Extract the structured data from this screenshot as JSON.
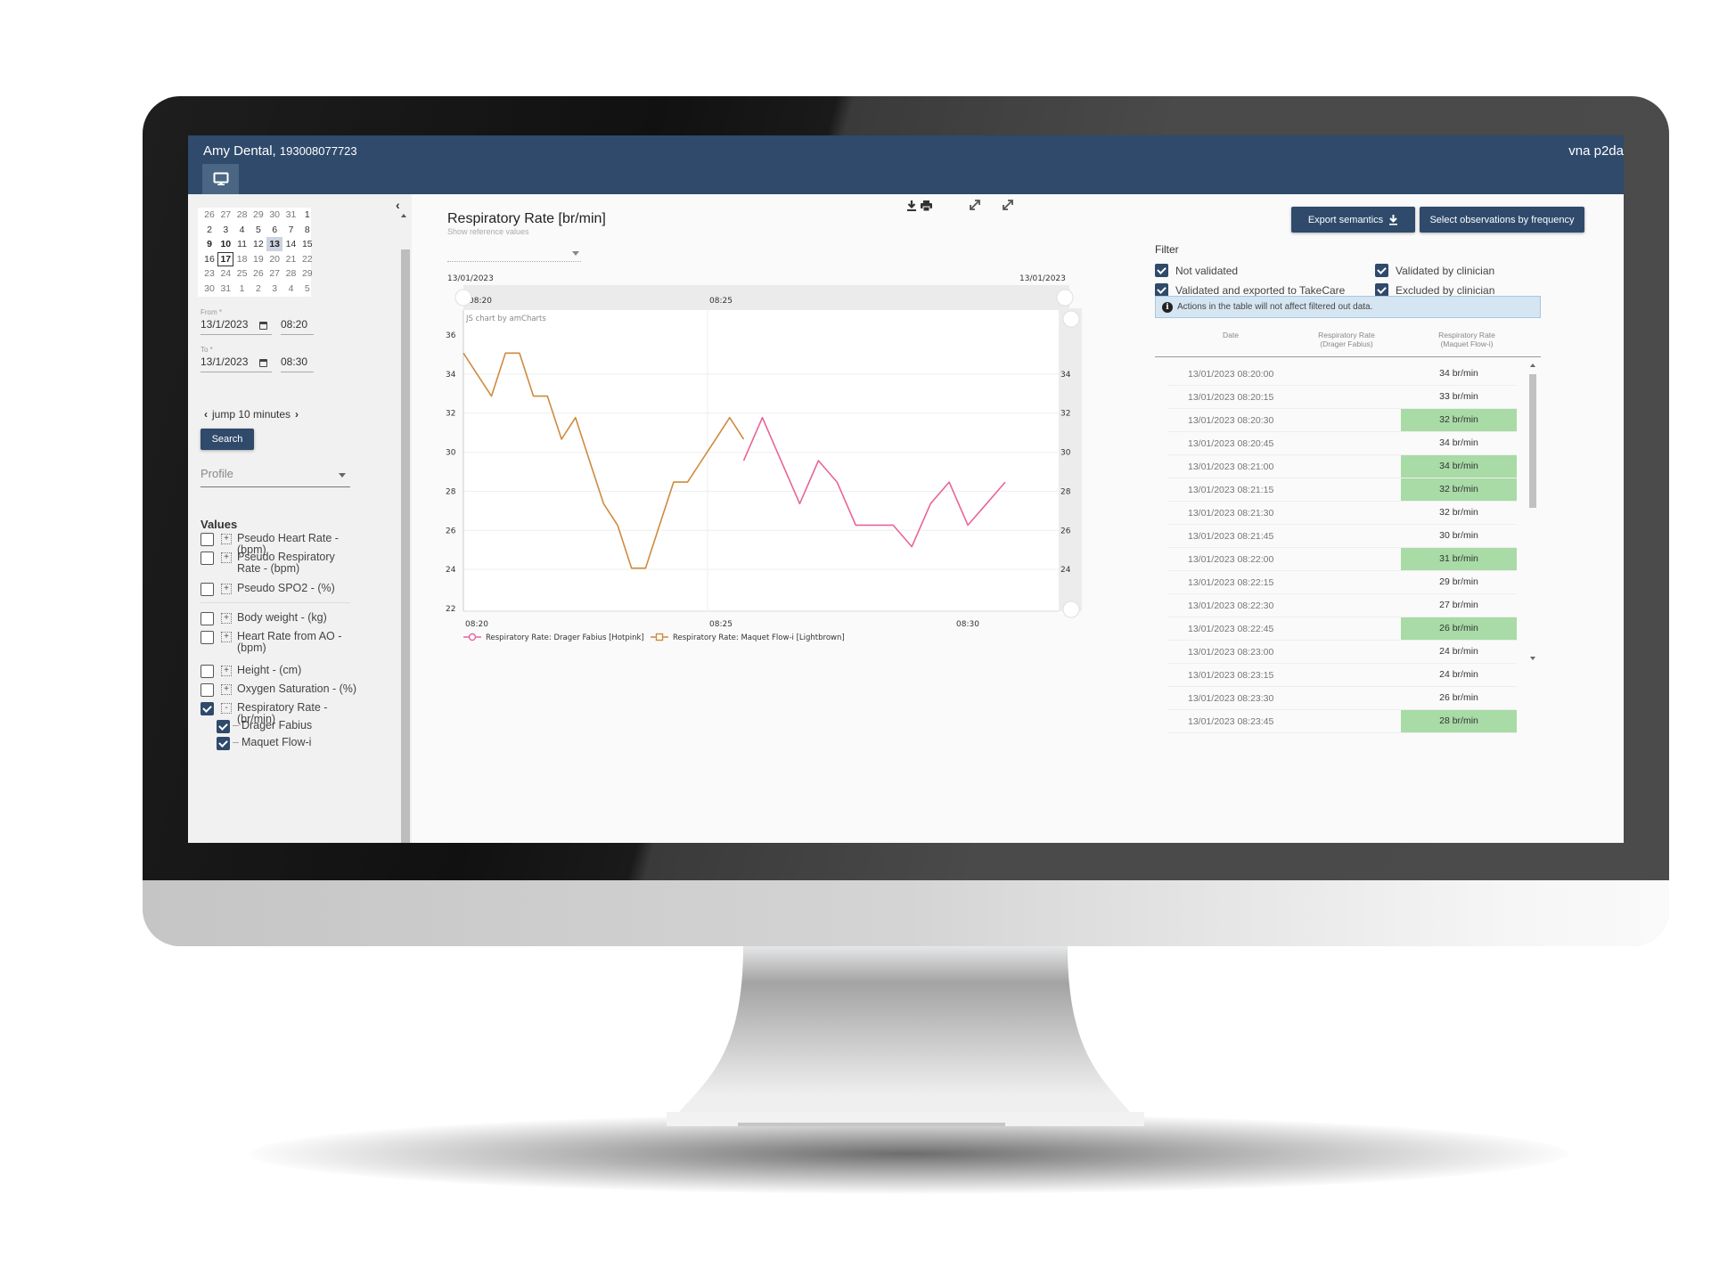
{
  "header": {
    "patient_name": "Amy Dental,",
    "patient_id": "193008077723",
    "user": "vna p2da",
    "tab_icon": "monitor-icon"
  },
  "sidebar": {
    "collapse_icon": "chevron-left-icon",
    "calendar": {
      "weeks": [
        [
          {
            "d": "26",
            "t": "other"
          },
          {
            "d": "27",
            "t": "other"
          },
          {
            "d": "28",
            "t": "other"
          },
          {
            "d": "29",
            "t": "other"
          },
          {
            "d": "30",
            "t": "other"
          },
          {
            "d": "31",
            "t": "other"
          },
          {
            "d": "1",
            "t": "cur"
          }
        ],
        [
          {
            "d": "2",
            "t": "cur"
          },
          {
            "d": "3",
            "t": "cur"
          },
          {
            "d": "4",
            "t": "cur"
          },
          {
            "d": "5",
            "t": "cur"
          },
          {
            "d": "6",
            "t": "cur"
          },
          {
            "d": "7",
            "t": "cur"
          },
          {
            "d": "8",
            "t": "cur"
          }
        ],
        [
          {
            "d": "9",
            "t": "bold"
          },
          {
            "d": "10",
            "t": "bold"
          },
          {
            "d": "11",
            "t": "cur"
          },
          {
            "d": "12",
            "t": "cur"
          },
          {
            "d": "13",
            "t": "selected"
          },
          {
            "d": "14",
            "t": "cur"
          },
          {
            "d": "15",
            "t": "cur"
          }
        ],
        [
          {
            "d": "16",
            "t": "cur"
          },
          {
            "d": "17",
            "t": "today"
          },
          {
            "d": "18",
            "t": "other"
          },
          {
            "d": "19",
            "t": "other"
          },
          {
            "d": "20",
            "t": "other"
          },
          {
            "d": "21",
            "t": "other"
          },
          {
            "d": "22",
            "t": "other"
          }
        ],
        [
          {
            "d": "23",
            "t": "other"
          },
          {
            "d": "24",
            "t": "other"
          },
          {
            "d": "25",
            "t": "other"
          },
          {
            "d": "26",
            "t": "other"
          },
          {
            "d": "27",
            "t": "other"
          },
          {
            "d": "28",
            "t": "other"
          },
          {
            "d": "29",
            "t": "other"
          }
        ],
        [
          {
            "d": "30",
            "t": "other"
          },
          {
            "d": "31",
            "t": "other"
          },
          {
            "d": "1",
            "t": "other"
          },
          {
            "d": "2",
            "t": "other"
          },
          {
            "d": "3",
            "t": "other"
          },
          {
            "d": "4",
            "t": "other"
          },
          {
            "d": "5",
            "t": "other"
          }
        ]
      ]
    },
    "from": {
      "label": "From *",
      "date": "13/1/2023",
      "time": "08:20"
    },
    "to": {
      "label": "To *",
      "date": "13/1/2023",
      "time": "08:30"
    },
    "jump_label": "jump 10 minutes",
    "search_label": "Search",
    "profile_placeholder": "Profile",
    "values_heading": "Values",
    "values": [
      {
        "label": "Pseudo Heart Rate - (bpm)",
        "checked": false,
        "expander": "+"
      },
      {
        "label": "Pseudo Respiratory Rate - (bpm)",
        "checked": false,
        "expander": "+"
      },
      {
        "label": "Pseudo SPO2 - (%)",
        "checked": false,
        "expander": "+"
      },
      {
        "label": "Body weight - (kg)",
        "checked": false,
        "expander": "+"
      },
      {
        "label": "Heart Rate from AO - (bpm)",
        "checked": false,
        "expander": "+"
      },
      {
        "label": "Height - (cm)",
        "checked": false,
        "expander": "+"
      },
      {
        "label": "Oxygen Saturation - (%)",
        "checked": false,
        "expander": "+"
      },
      {
        "label": "Respiratory Rate - (br/min)",
        "checked": true,
        "expander": "-"
      }
    ],
    "sub_values": [
      {
        "label": "Drager Fabius",
        "checked": true
      },
      {
        "label": "Maquet Flow-i",
        "checked": true
      }
    ]
  },
  "chart_panel": {
    "title": "Respiratory Rate [br/min]",
    "subtitle": "Show reference values",
    "toolbar_icons": [
      "download-icon",
      "print-icon",
      "expand-icon",
      "expand-icon"
    ],
    "date_left": "13/01/2023",
    "date_right": "13/01/2023",
    "watermark": "JS chart by amCharts"
  },
  "chart_data": {
    "type": "line",
    "title": "Respiratory Rate [br/min]",
    "xlabel": "",
    "ylabel": "",
    "x_ticks": [
      "08:20",
      "08:25",
      "08:30"
    ],
    "x_range_minutes": [
      "08:20",
      "08:30"
    ],
    "y_ticks": [
      22,
      24,
      26,
      28,
      30,
      32,
      34,
      36
    ],
    "right_y_ticks": [
      24,
      26,
      28,
      30,
      32,
      34
    ],
    "ylim": [
      22,
      36
    ],
    "grid": true,
    "legend_position": "bottom-left",
    "series": [
      {
        "name": "Respiratory Rate: Drager Fabius [Hotpink]",
        "color": "#e8649a",
        "marker": "circle",
        "x": [
          "08:25:00",
          "08:25:20",
          "08:25:40",
          "08:26:00",
          "08:26:20",
          "08:26:40",
          "08:27:00",
          "08:27:20",
          "08:27:40",
          "08:28:00",
          "08:28:20",
          "08:28:40",
          "08:29:00",
          "08:29:20",
          "08:29:40"
        ],
        "values": [
          29,
          31,
          29,
          27,
          29,
          28,
          26,
          26,
          26,
          25,
          27,
          28,
          26,
          27,
          28
        ]
      },
      {
        "name": "Respiratory Rate: Maquet Flow-i [Lightbrown]",
        "color": "#cf8a3f",
        "marker": "square",
        "x": [
          "08:20:00",
          "08:20:15",
          "08:20:30",
          "08:20:45",
          "08:21:00",
          "08:21:15",
          "08:21:30",
          "08:21:45",
          "08:22:00",
          "08:22:15",
          "08:22:30",
          "08:22:45",
          "08:23:00",
          "08:23:15",
          "08:23:30",
          "08:23:45",
          "08:24:00",
          "08:24:15",
          "08:24:30",
          "08:24:45",
          "08:25:00"
        ],
        "values": [
          34,
          33,
          32,
          34,
          34,
          32,
          32,
          30,
          31,
          29,
          27,
          26,
          24,
          24,
          26,
          28,
          28,
          29,
          30,
          31,
          30
        ]
      }
    ]
  },
  "right_panel": {
    "export_label": "Export semantics",
    "select_freq_label": "Select observations by frequency",
    "filter_heading": "Filter",
    "filters": [
      {
        "label": "Not validated",
        "checked": true
      },
      {
        "label": "Validated by clinician",
        "checked": true
      },
      {
        "label": "Validated and exported to TakeCare",
        "checked": true
      },
      {
        "label": "Excluded by clinician",
        "checked": true
      }
    ],
    "info_text": "Actions in the table will not affect filtered out data.",
    "table": {
      "headers": [
        "Date",
        "Respiratory Rate\n(Drager Fabius)",
        "Respiratory Rate\n(Maquet Flow-i)"
      ],
      "header_lines": [
        [
          "Date"
        ],
        [
          "Respiratory Rate",
          "(Drager Fabius)"
        ],
        [
          "Respiratory Rate",
          "(Maquet Flow-i)"
        ]
      ],
      "rows": [
        {
          "date": "13/01/2023 08:20:00",
          "drager": "",
          "maquet": "34 br/min",
          "validated": false
        },
        {
          "date": "13/01/2023 08:20:15",
          "drager": "",
          "maquet": "33 br/min",
          "validated": false
        },
        {
          "date": "13/01/2023 08:20:30",
          "drager": "",
          "maquet": "32 br/min",
          "validated": true
        },
        {
          "date": "13/01/2023 08:20:45",
          "drager": "",
          "maquet": "34 br/min",
          "validated": false
        },
        {
          "date": "13/01/2023 08:21:00",
          "drager": "",
          "maquet": "34 br/min",
          "validated": true
        },
        {
          "date": "13/01/2023 08:21:15",
          "drager": "",
          "maquet": "32 br/min",
          "validated": true
        },
        {
          "date": "13/01/2023 08:21:30",
          "drager": "",
          "maquet": "32 br/min",
          "validated": false
        },
        {
          "date": "13/01/2023 08:21:45",
          "drager": "",
          "maquet": "30 br/min",
          "validated": false
        },
        {
          "date": "13/01/2023 08:22:00",
          "drager": "",
          "maquet": "31 br/min",
          "validated": true
        },
        {
          "date": "13/01/2023 08:22:15",
          "drager": "",
          "maquet": "29 br/min",
          "validated": false
        },
        {
          "date": "13/01/2023 08:22:30",
          "drager": "",
          "maquet": "27 br/min",
          "validated": false
        },
        {
          "date": "13/01/2023 08:22:45",
          "drager": "",
          "maquet": "26 br/min",
          "validated": true
        },
        {
          "date": "13/01/2023 08:23:00",
          "drager": "",
          "maquet": "24 br/min",
          "validated": false
        },
        {
          "date": "13/01/2023 08:23:15",
          "drager": "",
          "maquet": "24 br/min",
          "validated": false
        },
        {
          "date": "13/01/2023 08:23:30",
          "drager": "",
          "maquet": "26 br/min",
          "validated": false
        },
        {
          "date": "13/01/2023 08:23:45",
          "drager": "",
          "maquet": "28 br/min",
          "validated": true
        }
      ],
      "highlight_color": "#a8dba6"
    }
  }
}
